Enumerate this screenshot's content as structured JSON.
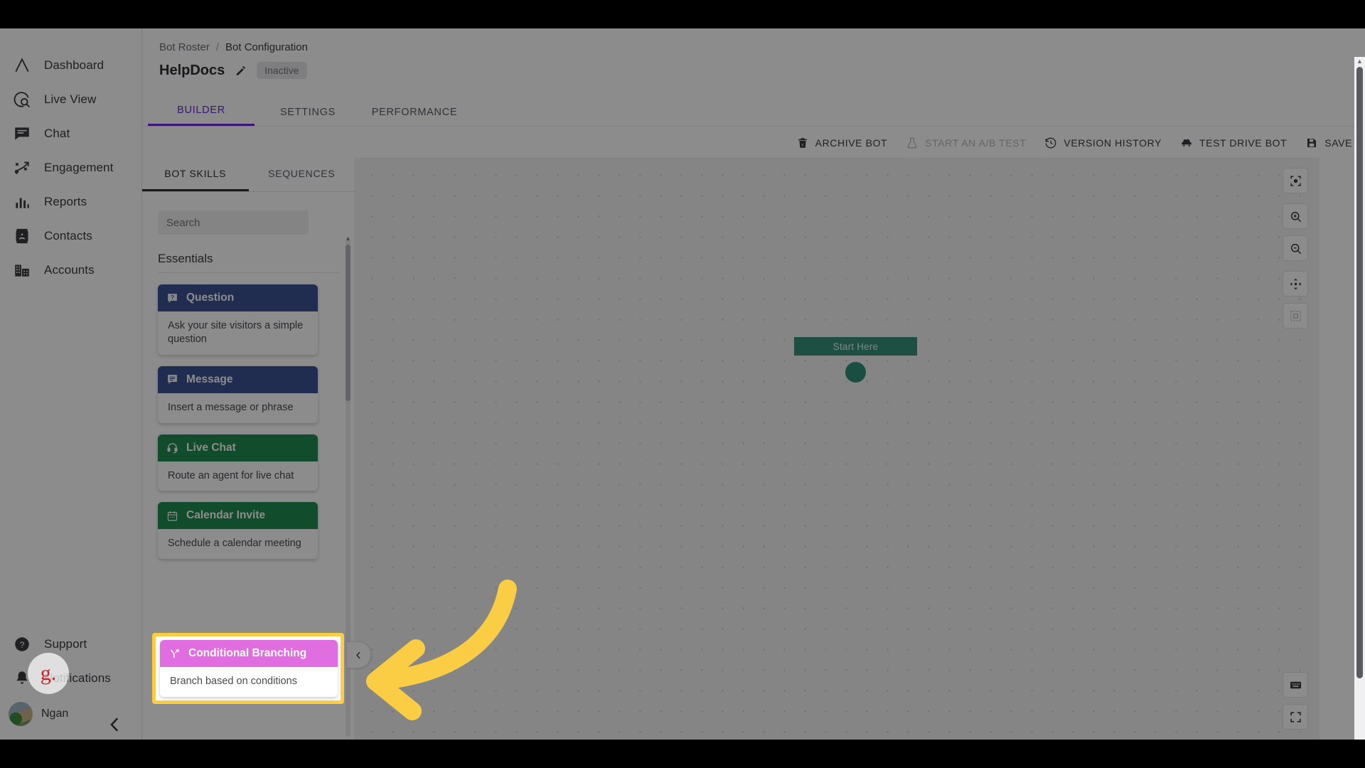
{
  "app": {
    "product_logo": "lambda-logo-icon"
  },
  "sidebar": {
    "items": [
      {
        "label": "Dashboard",
        "icon": "dashboard-icon"
      },
      {
        "label": "Live View",
        "icon": "live-view-icon"
      },
      {
        "label": "Chat",
        "icon": "chat-icon"
      },
      {
        "label": "Engagement",
        "icon": "engagement-icon"
      },
      {
        "label": "Reports",
        "icon": "reports-icon"
      },
      {
        "label": "Contacts",
        "icon": "contacts-icon"
      },
      {
        "label": "Accounts",
        "icon": "accounts-icon"
      }
    ],
    "bottom": [
      {
        "label": "Support",
        "icon": "help-circle-icon"
      },
      {
        "label": "Notifications",
        "icon": "bell-icon"
      }
    ],
    "user": {
      "name": "Ngan",
      "avatar": "user-avatar",
      "badge": "g."
    },
    "collapse_icon": "chevron-left-icon"
  },
  "breadcrumb": {
    "parent": "Bot Roster",
    "separator": "/",
    "current": "Bot Configuration"
  },
  "bot": {
    "name": "HelpDocs",
    "edit_icon": "pencil-icon",
    "status": "Inactive"
  },
  "tabs": [
    {
      "label": "BUILDER",
      "active": true
    },
    {
      "label": "SETTINGS",
      "active": false
    },
    {
      "label": "PERFORMANCE",
      "active": false
    }
  ],
  "actions": [
    {
      "label": "ARCHIVE BOT",
      "icon": "trash-icon",
      "disabled": false
    },
    {
      "label": "START AN A/B TEST",
      "icon": "flask-icon",
      "disabled": true
    },
    {
      "label": "VERSION HISTORY",
      "icon": "history-clock-icon",
      "disabled": false
    },
    {
      "label": "TEST DRIVE BOT",
      "icon": "car-icon",
      "disabled": false
    },
    {
      "label": "SAVE",
      "icon": "save-floppy-icon",
      "disabled": false
    }
  ],
  "panel": {
    "tabs": [
      {
        "label": "BOT SKILLS",
        "active": true
      },
      {
        "label": "SEQUENCES",
        "active": false
      }
    ],
    "search": {
      "value": "",
      "placeholder": "Search"
    },
    "group_title": "Essentials",
    "cards": [
      {
        "title": "Question",
        "description": "Ask your site visitors a simple question",
        "icon": "question-bubble-icon",
        "color": "#3b5193"
      },
      {
        "title": "Message",
        "description": "Insert a message or phrase",
        "icon": "message-bubble-icon",
        "color": "#3b5193"
      },
      {
        "title": "Live Chat",
        "description": "Route an agent for live chat",
        "icon": "headset-icon",
        "color": "#1f8a53"
      },
      {
        "title": "Calendar Invite",
        "description": "Schedule a calendar meeting",
        "icon": "calendar-icon",
        "color": "#1f8a53"
      }
    ],
    "highlighted_card": {
      "title": "Conditional Branching",
      "description": "Branch based on conditions",
      "icon": "branch-icon",
      "color": "#e06ee0",
      "highlight_border": "#facd45"
    },
    "collapse_icon": "chevron-left-icon"
  },
  "canvas": {
    "start_node": {
      "label": "Start Here",
      "color": "#35907a"
    },
    "tools_top": [
      {
        "name": "center-focus-icon"
      },
      {
        "name": "zoom-in-icon"
      },
      {
        "name": "zoom-out-icon"
      },
      {
        "name": "pan-move-icon"
      },
      {
        "name": "select-area-icon"
      }
    ],
    "tools_bottom": [
      {
        "name": "keyboard-shortcuts-icon"
      },
      {
        "name": "fullscreen-icon"
      }
    ]
  },
  "annotation": {
    "type": "arrow",
    "color": "#facd45",
    "points_to": "conditional-branching-card"
  }
}
